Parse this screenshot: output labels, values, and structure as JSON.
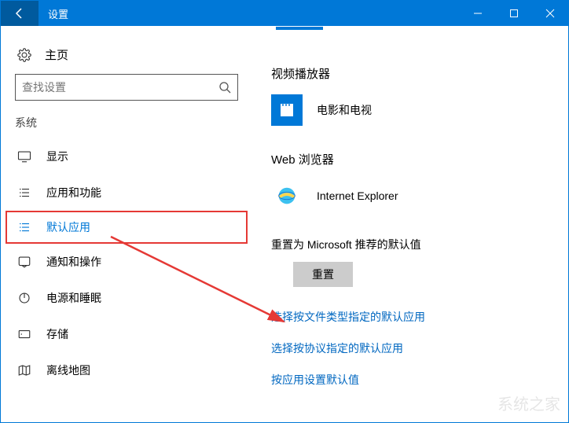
{
  "window": {
    "title": "设置"
  },
  "sidebar": {
    "home": "主页",
    "search_placeholder": "查找设置",
    "category": "系统",
    "items": [
      {
        "label": "显示"
      },
      {
        "label": "应用和功能"
      },
      {
        "label": "默认应用"
      },
      {
        "label": "通知和操作"
      },
      {
        "label": "电源和睡眠"
      },
      {
        "label": "存储"
      },
      {
        "label": "离线地图"
      }
    ]
  },
  "content": {
    "video_section": "视频播放器",
    "video_app": "电影和电视",
    "web_section": "Web 浏览器",
    "web_app": "Internet Explorer",
    "reset_title": "重置为 Microsoft 推荐的默认值",
    "reset_button": "重置",
    "link_filetype": "选择按文件类型指定的默认应用",
    "link_protocol": "选择按协议指定的默认应用",
    "link_byapp": "按应用设置默认值"
  },
  "watermark": "系统之家"
}
